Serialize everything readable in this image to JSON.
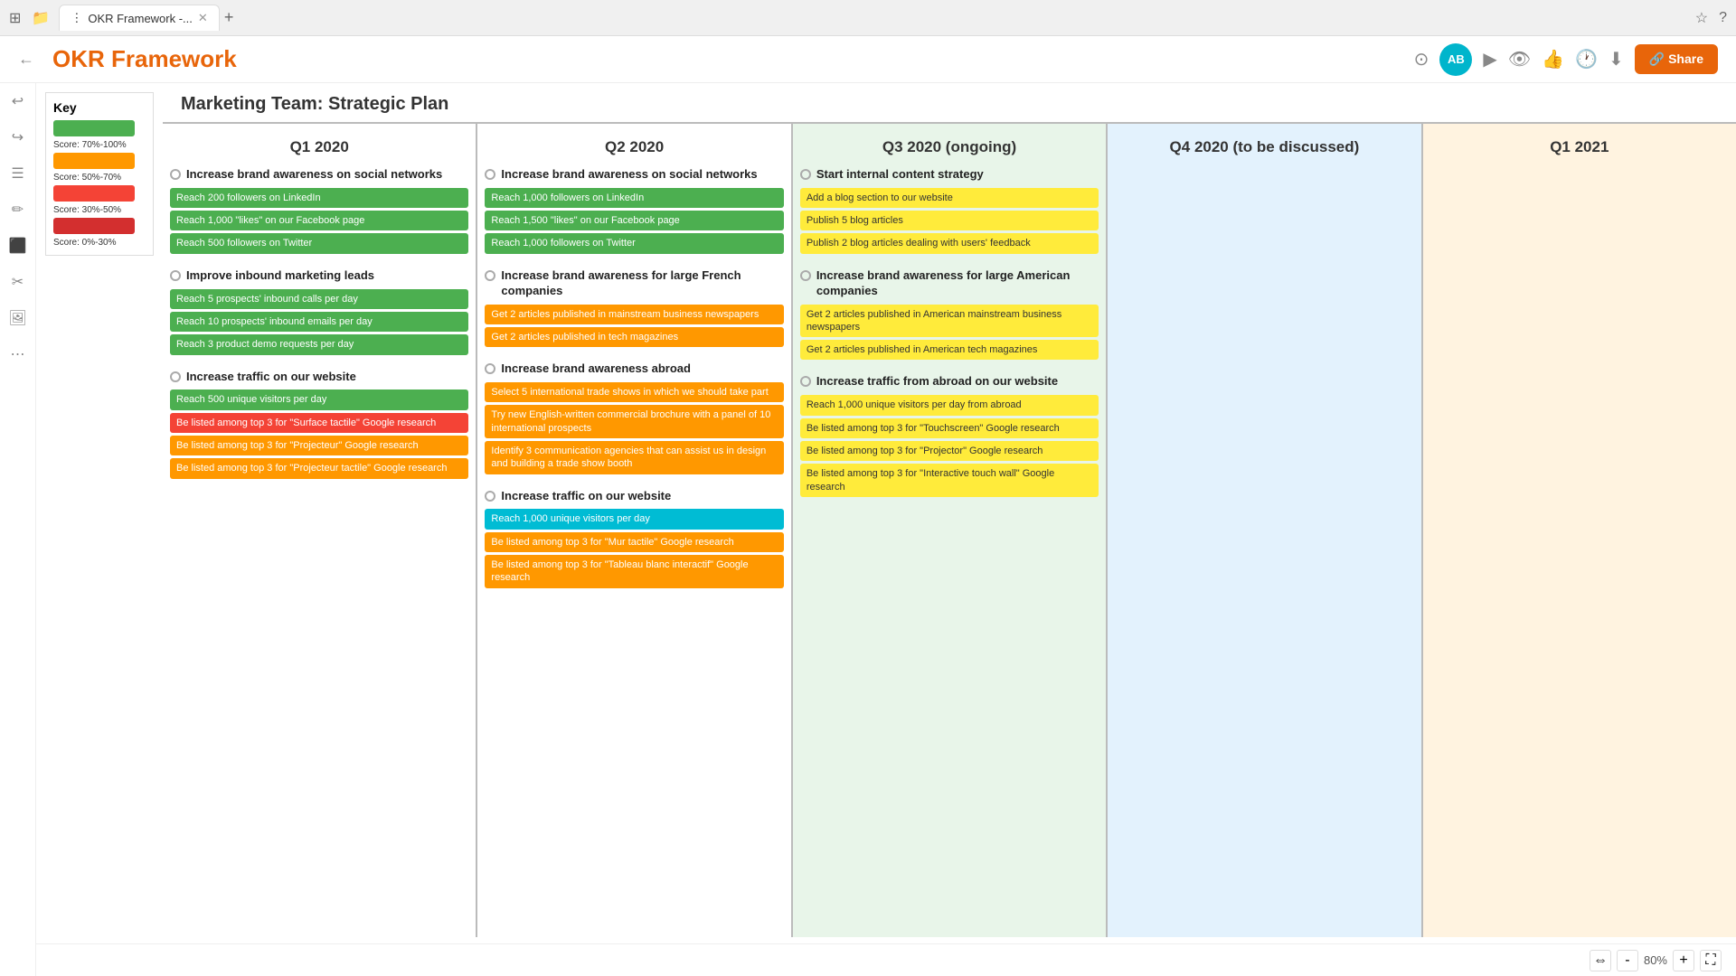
{
  "browser": {
    "tab_label": "OKR Framework -...",
    "new_tab_label": "+",
    "icons": [
      "⊞",
      "📁",
      "⋮"
    ]
  },
  "toolbar": {
    "title": "OKR Framework",
    "share_label": "🔗 Share",
    "avatar": "AB",
    "icons": [
      "⊙",
      "▶",
      "👁",
      "👍",
      "🕐",
      "⬇"
    ]
  },
  "key": {
    "title": "Key",
    "items": [
      {
        "label": "Score: 70%-100%",
        "color": "#4caf50"
      },
      {
        "label": "Score: 50%-70%",
        "color": "#ff9800"
      },
      {
        "label": "Score: 30%-50%",
        "color": "#f44336"
      },
      {
        "label": "Score: 0%-30%",
        "color": "#f44336"
      }
    ]
  },
  "page_title": "Marketing Team: Strategic Plan",
  "columns": [
    {
      "id": "q1-2020",
      "header": "Q1 2020",
      "bg": "#ffffff",
      "objectives": [
        {
          "title": "Increase brand awareness on social networks",
          "key_results": [
            {
              "text": "Reach 200 followers on LinkedIn",
              "color": "green"
            },
            {
              "text": "Reach 1,000 \"likes\" on our Facebook page",
              "color": "green"
            },
            {
              "text": "Reach 500 followers on Twitter",
              "color": "green"
            }
          ]
        },
        {
          "title": "Improve inbound marketing leads",
          "key_results": [
            {
              "text": "Reach 5 prospects' inbound calls per day",
              "color": "green"
            },
            {
              "text": "Reach 10 prospects' inbound emails per day",
              "color": "green"
            },
            {
              "text": "Reach 3 product demo requests per day",
              "color": "green"
            }
          ]
        },
        {
          "title": "Increase traffic on our website",
          "key_results": [
            {
              "text": "Reach 500 unique visitors per day",
              "color": "green"
            },
            {
              "text": "Be listed among top 3 for \"Surface tactile\" Google research",
              "color": "red"
            },
            {
              "text": "Be listed among top 3 for \"Projecteur\" Google research",
              "color": "orange"
            },
            {
              "text": "Be listed among top 3 for \"Projecteur tactile\" Google research",
              "color": "orange"
            }
          ]
        }
      ]
    },
    {
      "id": "q2-2020",
      "header": "Q2 2020",
      "bg": "#ffffff",
      "objectives": [
        {
          "title": "Increase brand awareness on social networks",
          "key_results": [
            {
              "text": "Reach 1,000 followers on LinkedIn",
              "color": "green"
            },
            {
              "text": "Reach 1,500 \"likes\" on our Facebook page",
              "color": "green"
            },
            {
              "text": "Reach 1,000 followers on Twitter",
              "color": "green"
            }
          ]
        },
        {
          "title": "Increase brand awareness for large French companies",
          "key_results": [
            {
              "text": "Get 2 articles published in mainstream business newspapers",
              "color": "orange"
            },
            {
              "text": "Get 2 articles published in tech magazines",
              "color": "orange"
            }
          ]
        },
        {
          "title": "Increase brand awareness abroad",
          "key_results": [
            {
              "text": "Select 5 international trade shows in which we should take part",
              "color": "orange"
            },
            {
              "text": "Try new English-written commercial brochure with a panel of 10 international prospects",
              "color": "orange"
            },
            {
              "text": "Identify 3 communication agencies that can assist us in design and building a trade show booth",
              "color": "orange"
            }
          ]
        },
        {
          "title": "Increase traffic on our website",
          "key_results": [
            {
              "text": "Reach 1,000 unique visitors per day",
              "color": "blue"
            },
            {
              "text": "Be listed among top 3 for \"Mur tactile\" Google research",
              "color": "orange"
            },
            {
              "text": "Be listed among top 3 for \"Tableau blanc interactif\" Google research",
              "color": "orange"
            }
          ]
        }
      ]
    },
    {
      "id": "q3-2020",
      "header": "Q3 2020 (ongoing)",
      "bg": "#e8f5e9",
      "objectives": [
        {
          "title": "Start internal content strategy",
          "key_results": [
            {
              "text": "Add a blog section to our website",
              "color": "yellow"
            },
            {
              "text": "Publish 5 blog articles",
              "color": "yellow"
            },
            {
              "text": "Publish 2 blog articles dealing with users' feedback",
              "color": "yellow"
            }
          ]
        },
        {
          "title": "Increase brand awareness for large American companies",
          "key_results": [
            {
              "text": "Get 2 articles published in American mainstream business newspapers",
              "color": "yellow"
            },
            {
              "text": "Get 2 articles published in American tech magazines",
              "color": "yellow"
            }
          ]
        },
        {
          "title": "Increase traffic from abroad on our website",
          "key_results": [
            {
              "text": "Reach 1,000 unique visitors per day from abroad",
              "color": "yellow"
            },
            {
              "text": "Be listed among top 3 for \"Touchscreen\" Google research",
              "color": "yellow"
            },
            {
              "text": "Be listed among top 3 for \"Projector\" Google research",
              "color": "yellow"
            },
            {
              "text": "Be listed among top 3 for \"Interactive touch wall\" Google research",
              "color": "yellow"
            }
          ]
        }
      ]
    },
    {
      "id": "q4-2020",
      "header": "Q4 2020 (to be discussed)",
      "bg": "#e3f2fd",
      "objectives": []
    },
    {
      "id": "q1-2021",
      "header": "Q1 2021",
      "bg": "#fff3e0",
      "objectives": []
    }
  ],
  "bottom": {
    "zoom": "80%",
    "zoom_in": "+",
    "zoom_out": "-"
  },
  "sidebar_icons": [
    "↩",
    "↪",
    "☰",
    "✏",
    "⬛",
    "✂",
    "🖼",
    "⋯"
  ]
}
